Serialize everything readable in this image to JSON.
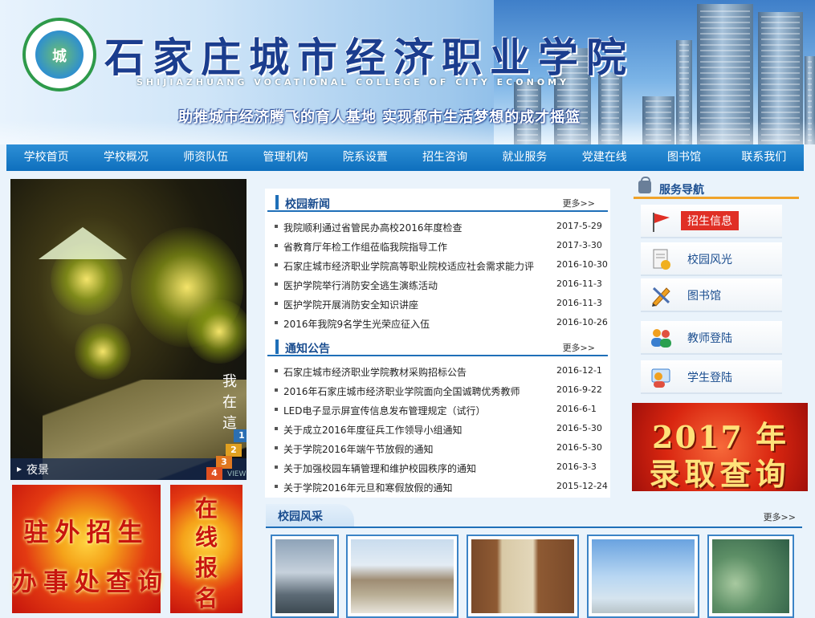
{
  "header": {
    "title": "石家庄城市经济职业学院",
    "subtitle_en": "SHIJIAZHUANG VOCATIONAL COLLEGE OF CITY ECONOMY",
    "slogan": "助推城市经济腾飞的育人基地   实现都市生活梦想的成才摇篮",
    "logo_mark": "城"
  },
  "nav": {
    "items": [
      "学校首页",
      "学校概况",
      "师资队伍",
      "管理机构",
      "院系设置",
      "招生咨询",
      "就业服务",
      "党建在线",
      "图书馆",
      "联系我们"
    ]
  },
  "slideshow": {
    "caption": "夜景",
    "vertical_text": "我在這",
    "numbers": [
      "1",
      "2",
      "3",
      "4"
    ],
    "view_label": "VIEW"
  },
  "ads": {
    "office_line1": "驻外招生",
    "office_line2": "办事处查询",
    "online_chars": [
      "在",
      "线",
      "报",
      "名"
    ],
    "result_line1": "2017 年",
    "result_line2": "录取查询"
  },
  "campus_news": {
    "title": "校园新闻",
    "more": "更多>>",
    "items": [
      {
        "title": "我院顺利通过省管民办高校2016年度检查",
        "date": "2017-5-29"
      },
      {
        "title": "省教育厅年检工作组莅临我院指导工作",
        "date": "2017-3-30"
      },
      {
        "title": "石家庄城市经济职业学院高等职业院校适应社会需求能力评",
        "date": "2016-10-30"
      },
      {
        "title": "医护学院举行消防安全逃生演练活动",
        "date": "2016-11-3"
      },
      {
        "title": "医护学院开展消防安全知识讲座",
        "date": "2016-11-3"
      },
      {
        "title": "2016年我院9名学生光荣应征入伍",
        "date": "2016-10-26"
      }
    ]
  },
  "notices": {
    "title": "通知公告",
    "more": "更多>>",
    "items": [
      {
        "title": "石家庄城市经济职业学院教材采购招标公告",
        "date": "2016-12-1"
      },
      {
        "title": "2016年石家庄城市经济职业学院面向全国诚聘优秀教师",
        "date": "2016-9-22"
      },
      {
        "title": "LED电子显示屏宣传信息发布管理规定（试行）",
        "date": "2016-6-1"
      },
      {
        "title": "关于成立2016年度征兵工作领导小组通知",
        "date": "2016-5-30"
      },
      {
        "title": "关于学院2016年端午节放假的通知",
        "date": "2016-5-30"
      },
      {
        "title": "关于加强校园车辆管理和维护校园秩序的通知",
        "date": "2016-3-3"
      },
      {
        "title": "关于学院2016年元旦和寒假放假的通知",
        "date": "2015-12-24"
      }
    ]
  },
  "campus_style": {
    "title": "校园风采",
    "more": "更多>>"
  },
  "service_nav": {
    "title": "服务导航",
    "items": [
      {
        "label": "招生信息",
        "icon": "flag-icon"
      },
      {
        "label": "校园风光",
        "icon": "document-icon"
      },
      {
        "label": "图书馆",
        "icon": "pencil-icon"
      },
      {
        "label": "教师登陆",
        "icon": "users-icon"
      },
      {
        "label": "学生登陆",
        "icon": "student-icon"
      }
    ]
  },
  "colors": {
    "nav_blue": "#0e6fbd",
    "accent_red": "#e02f25",
    "title_blue": "#1a4d8f",
    "service_underline": "#f0a32a"
  }
}
